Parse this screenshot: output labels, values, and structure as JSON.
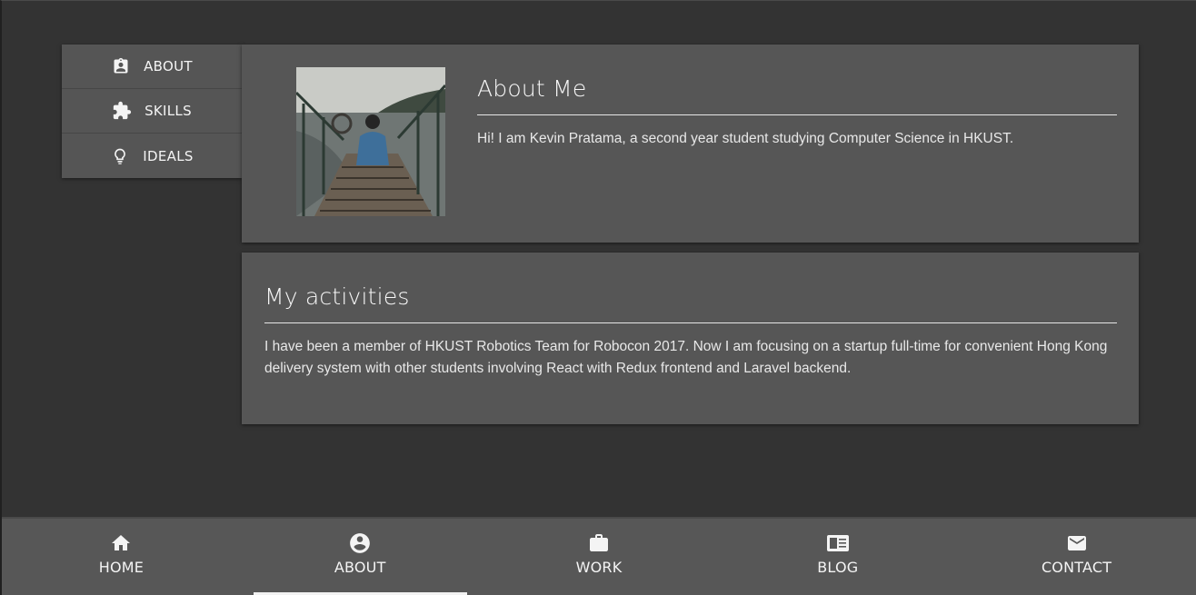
{
  "side_nav": {
    "items": [
      {
        "label": "ABOUT",
        "icon": "assignment-ind-icon"
      },
      {
        "label": "SKILLS",
        "icon": "puzzle-icon"
      },
      {
        "label": "IDEALS",
        "icon": "lightbulb-icon"
      }
    ]
  },
  "about": {
    "title": "About Me",
    "body": "Hi! I am Kevin Pratama, a second year student studying Computer Science in HKUST."
  },
  "activities": {
    "title": "My activities",
    "body": "I have been a member of HKUST Robotics Team for Robocon 2017. Now I am focusing on a startup full-time for convenient Hong Kong delivery system with other students involving React with Redux frontend and Laravel backend."
  },
  "bottom_nav": {
    "items": [
      {
        "label": "HOME",
        "icon": "home-icon"
      },
      {
        "label": "ABOUT",
        "icon": "account-circle-icon",
        "active": true
      },
      {
        "label": "WORK",
        "icon": "briefcase-icon"
      },
      {
        "label": "BLOG",
        "icon": "article-icon"
      },
      {
        "label": "CONTACT",
        "icon": "mail-icon"
      }
    ]
  },
  "colors": {
    "background": "#333333",
    "card": "#565656",
    "nav": "#575757",
    "text": "#f4f4f4"
  }
}
